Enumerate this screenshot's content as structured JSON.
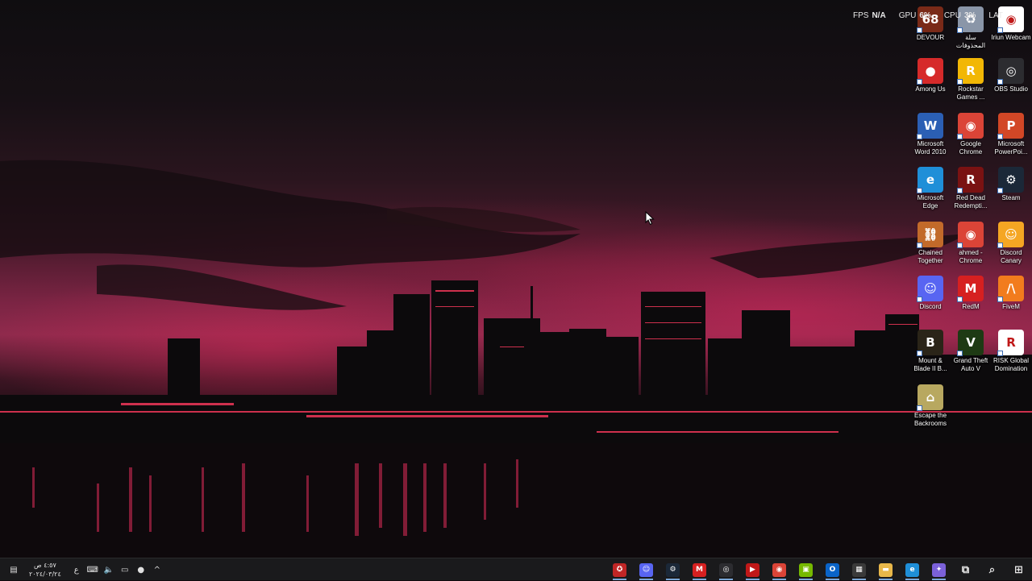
{
  "overlay": {
    "fps_label": "FPS",
    "fps_value": "N/A",
    "gpu_label": "GPU",
    "gpu_value": "6%",
    "cpu_label": "CPU",
    "cpu_value": "3%",
    "lat_label": "LAT"
  },
  "desktop_icons": [
    {
      "label": "DEVOUR",
      "icon": "devour-icon",
      "color": "#7a2a18",
      "glyph": "68"
    },
    {
      "label": "سلة المحذوفات",
      "icon": "recycle-bin-icon",
      "color": "#8a96a8",
      "glyph": "♻"
    },
    {
      "label": "Iriun Webcam",
      "icon": "webcam-icon",
      "color": "#ffffff",
      "glyph": "◉"
    },
    {
      "label": "Among Us",
      "icon": "among-us-icon",
      "color": "#d62a2a",
      "glyph": "●"
    },
    {
      "label": "Rockstar Games ...",
      "icon": "rockstar-icon",
      "color": "#f2b705",
      "glyph": "R"
    },
    {
      "label": "OBS Studio",
      "icon": "obs-icon",
      "color": "#2c2c30",
      "glyph": "◎"
    },
    {
      "label": "Microsoft Word 2010",
      "icon": "word-icon",
      "color": "#2b5fb4",
      "glyph": "W"
    },
    {
      "label": "Google Chrome",
      "icon": "chrome-icon",
      "color": "#db4437",
      "glyph": "◉"
    },
    {
      "label": "Microsoft PowerPoi...",
      "icon": "powerpoint-icon",
      "color": "#d24726",
      "glyph": "P"
    },
    {
      "label": "Microsoft Edge",
      "icon": "edge-icon",
      "color": "#1f8fd8",
      "glyph": "e"
    },
    {
      "label": "Red Dead Redempti...",
      "icon": "red-dead-icon",
      "color": "#7a1212",
      "glyph": "R"
    },
    {
      "label": "Steam",
      "icon": "steam-icon",
      "color": "#1b2838",
      "glyph": "⚙"
    },
    {
      "label": "Chained Together",
      "icon": "chained-together-icon",
      "color": "#c26a2a",
      "glyph": "⛓"
    },
    {
      "label": "ahmed - Chrome",
      "icon": "chrome-profile-icon",
      "color": "#db4437",
      "glyph": "◉"
    },
    {
      "label": "Discord Canary",
      "icon": "discord-canary-icon",
      "color": "#f5a623",
      "glyph": "☺"
    },
    {
      "label": "Discord",
      "icon": "discord-icon",
      "color": "#5865f2",
      "glyph": "☺"
    },
    {
      "label": "RedM",
      "icon": "redm-icon",
      "color": "#d62020",
      "glyph": "M"
    },
    {
      "label": "FiveM",
      "icon": "fivem-icon",
      "color": "#f27c1d",
      "glyph": "/\\"
    },
    {
      "label": "Mount & Blade II B...",
      "icon": "bannerlord-icon",
      "color": "#2a2418",
      "glyph": "B"
    },
    {
      "label": "Grand Theft Auto V",
      "icon": "gta-icon",
      "color": "#1e3a14",
      "glyph": "V"
    },
    {
      "label": "RISK Global Domination",
      "icon": "risk-icon",
      "color": "#ffffff",
      "glyph": "R"
    },
    {
      "label": "Escape the Backrooms",
      "icon": "backrooms-icon",
      "color": "#b8a860",
      "glyph": "⌂"
    }
  ],
  "taskbar": {
    "time": "٤:٥٧ ص",
    "date": "٢٠٢٤/٠٣/٢٤",
    "lang": "ع",
    "apps": [
      {
        "name": "game-app-icon",
        "color": "#c02626",
        "glyph": "✪"
      },
      {
        "name": "discord-canary-taskbar-icon",
        "color": "#5865f2",
        "glyph": "☺"
      },
      {
        "name": "steam-taskbar-icon",
        "color": "#1b2838",
        "glyph": "⚙"
      },
      {
        "name": "redm-taskbar-icon",
        "color": "#d62020",
        "glyph": "M"
      },
      {
        "name": "obs-taskbar-icon",
        "color": "#2c2c30",
        "glyph": "◎"
      },
      {
        "name": "voice-app-taskbar-icon",
        "color": "#c01818",
        "glyph": "▶"
      },
      {
        "name": "chrome-taskbar-icon",
        "color": "#db4437",
        "glyph": "◉"
      },
      {
        "name": "nvidia-taskbar-icon",
        "color": "#76b900",
        "glyph": "▣"
      },
      {
        "name": "outlook-taskbar-icon",
        "color": "#0a64c8",
        "glyph": "O"
      },
      {
        "name": "store-taskbar-icon",
        "color": "#3a3a3a",
        "glyph": "▦"
      },
      {
        "name": "file-explorer-taskbar-icon",
        "color": "#e8b84a",
        "glyph": "▬"
      },
      {
        "name": "edge-taskbar-icon",
        "color": "#1f8fd8",
        "glyph": "e"
      },
      {
        "name": "copilot-taskbar-icon",
        "color": "#7b61d9",
        "glyph": "✦"
      },
      {
        "name": "task-view-icon",
        "color": "#1a1a1c",
        "glyph": "⧉"
      },
      {
        "name": "search-icon",
        "color": "#1a1a1c",
        "glyph": "⌕"
      },
      {
        "name": "start-icon",
        "color": "#1a1a1c",
        "glyph": "⊞"
      }
    ]
  }
}
